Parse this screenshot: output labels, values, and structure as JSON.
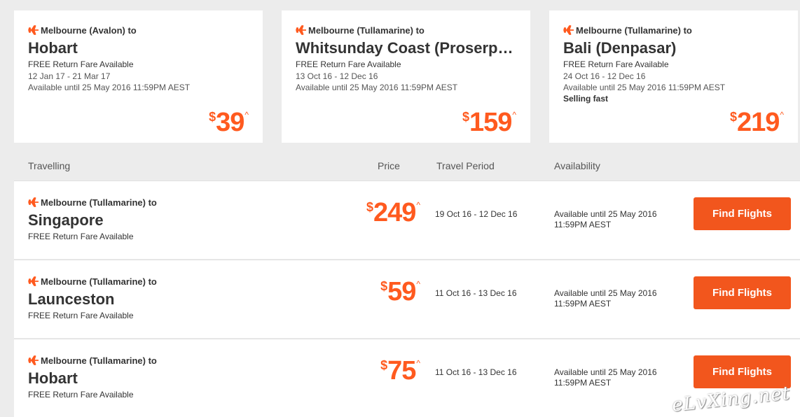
{
  "featured": [
    {
      "from": "Melbourne (Avalon) to",
      "destination": "Hobart",
      "free": "FREE Return Fare Available",
      "dates": "12 Jan 17 - 21 Mar 17",
      "availability": "Available until 25 May 2016 11:59PM AEST",
      "selling": "",
      "currency": "$",
      "price": "39",
      "caret": "^"
    },
    {
      "from": "Melbourne (Tullamarine) to",
      "destination": "Whitsunday Coast (Proserpine)",
      "free": "FREE Return Fare Available",
      "dates": "13 Oct 16 - 12 Dec 16",
      "availability": "Available until 25 May 2016 11:59PM AEST",
      "selling": "",
      "currency": "$",
      "price": "159",
      "caret": "^"
    },
    {
      "from": "Melbourne (Tullamarine) to",
      "destination": "Bali (Denpasar)",
      "free": "FREE Return Fare Available",
      "dates": "24 Oct 16 - 12 Dec 16",
      "availability": "Available until 25 May 2016 11:59PM AEST",
      "selling": "Selling fast",
      "currency": "$",
      "price": "219",
      "caret": "^"
    }
  ],
  "table": {
    "headers": {
      "travelling": "Travelling",
      "price": "Price",
      "period": "Travel Period",
      "availability": "Availability"
    },
    "rows": [
      {
        "from": "Melbourne (Tullamarine) to",
        "destination": "Singapore",
        "free": "FREE Return Fare Available",
        "currency": "$",
        "price": "249",
        "caret": "^",
        "period": "19 Oct 16 - 12 Dec 16",
        "availability_line1": "Available until 25 May 2016",
        "availability_line2": "11:59PM AEST",
        "button": "Find Flights"
      },
      {
        "from": "Melbourne (Tullamarine) to",
        "destination": "Launceston",
        "free": "FREE Return Fare Available",
        "currency": "$",
        "price": "59",
        "caret": "^",
        "period": "11 Oct 16 - 13 Dec 16",
        "availability_line1": "Available until 25 May 2016",
        "availability_line2": "11:59PM AEST",
        "button": "Find Flights"
      },
      {
        "from": "Melbourne (Tullamarine) to",
        "destination": "Hobart",
        "free": "FREE Return Fare Available",
        "currency": "$",
        "price": "75",
        "caret": "^",
        "period": "11 Oct 16 - 13 Dec 16",
        "availability_line1": "Available until 25 May 2016",
        "availability_line2": "11:59PM AEST",
        "button": "Find Flights"
      }
    ]
  },
  "watermark": "eLvXing.net",
  "colors": {
    "accent": "#ff5a1f",
    "button": "#f2561d",
    "background": "#ececec"
  },
  "icons": {
    "route": "plane-icon"
  }
}
